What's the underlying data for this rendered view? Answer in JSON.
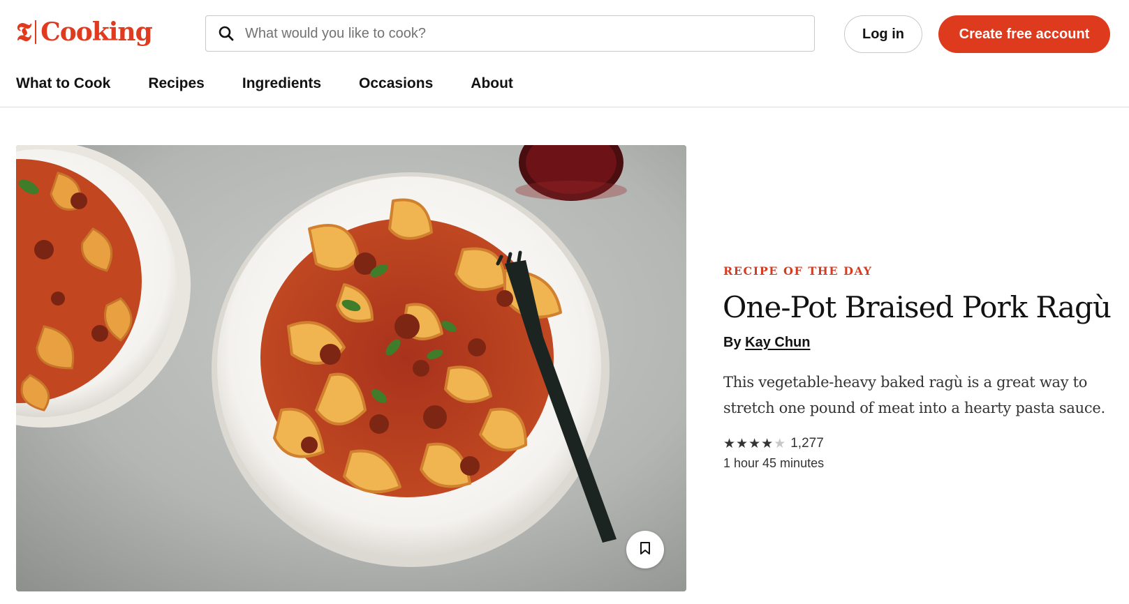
{
  "brand": {
    "mark": "𝕿",
    "name": "Cooking",
    "color": "#e03a1f"
  },
  "search": {
    "placeholder": "What would you like to cook?",
    "value": "",
    "icon": "search-icon"
  },
  "auth": {
    "login_label": "Log in",
    "create_label": "Create free account",
    "create_color": "#de3a1d"
  },
  "nav": {
    "items": [
      {
        "label": "What to Cook"
      },
      {
        "label": "Recipes"
      },
      {
        "label": "Ingredients"
      },
      {
        "label": "Occasions"
      },
      {
        "label": "About"
      }
    ]
  },
  "feature": {
    "eyebrow": "RECIPE OF THE DAY",
    "title": "One-Pot Braised Pork Ragù",
    "by_prefix": "By",
    "author": "Kay Chun",
    "description": "This vegetable-heavy baked ragù is a great way to stretch one pound of meat into a hearty pasta sauce.",
    "rating_stars": 4,
    "rating_max": 5,
    "rating_count": "1,277",
    "cook_time": "1 hour 45 minutes",
    "image_alt_icon": "bookmark-icon",
    "eyebrow_color": "#d53c21"
  }
}
